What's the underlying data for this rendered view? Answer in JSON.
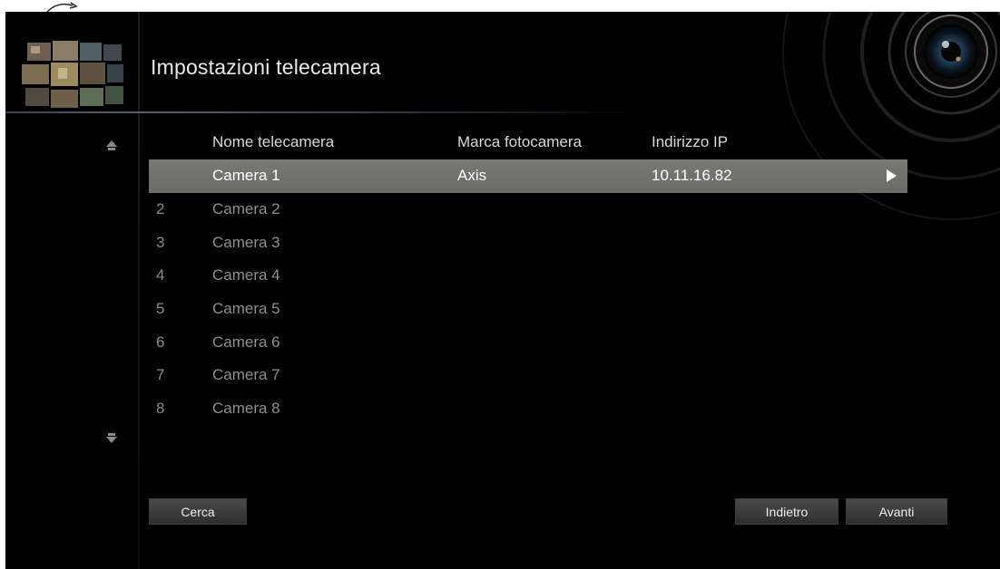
{
  "header": {
    "title": "Impostazioni telecamera"
  },
  "table": {
    "columns": {
      "name": "Nome telecamera",
      "brand": "Marca fotocamera",
      "ip": "Indirizzo IP"
    },
    "rows": [
      {
        "num": "",
        "name": "Camera 1",
        "brand": "Axis",
        "ip": "10.11.16.82",
        "selected": true
      },
      {
        "num": "2",
        "name": "Camera 2",
        "brand": "",
        "ip": ""
      },
      {
        "num": "3",
        "name": "Camera 3",
        "brand": "",
        "ip": ""
      },
      {
        "num": "4",
        "name": "Camera 4",
        "brand": "",
        "ip": ""
      },
      {
        "num": "5",
        "name": "Camera 5",
        "brand": "",
        "ip": ""
      },
      {
        "num": "6",
        "name": "Camera 6",
        "brand": "",
        "ip": ""
      },
      {
        "num": "7",
        "name": "Camera 7",
        "brand": "",
        "ip": ""
      },
      {
        "num": "8",
        "name": "Camera 8",
        "brand": "",
        "ip": ""
      }
    ]
  },
  "buttons": {
    "search": "Cerca",
    "back": "Indietro",
    "next": "Avanti"
  },
  "icons": {
    "scroll_up": "arrow-up-icon",
    "scroll_down": "arrow-down-icon",
    "row_go": "play-arrow-icon"
  },
  "colors": {
    "background": "#000000",
    "selected_row": "#737370",
    "text_primary": "#ffffff",
    "text_dim": "#8e8e8e"
  }
}
